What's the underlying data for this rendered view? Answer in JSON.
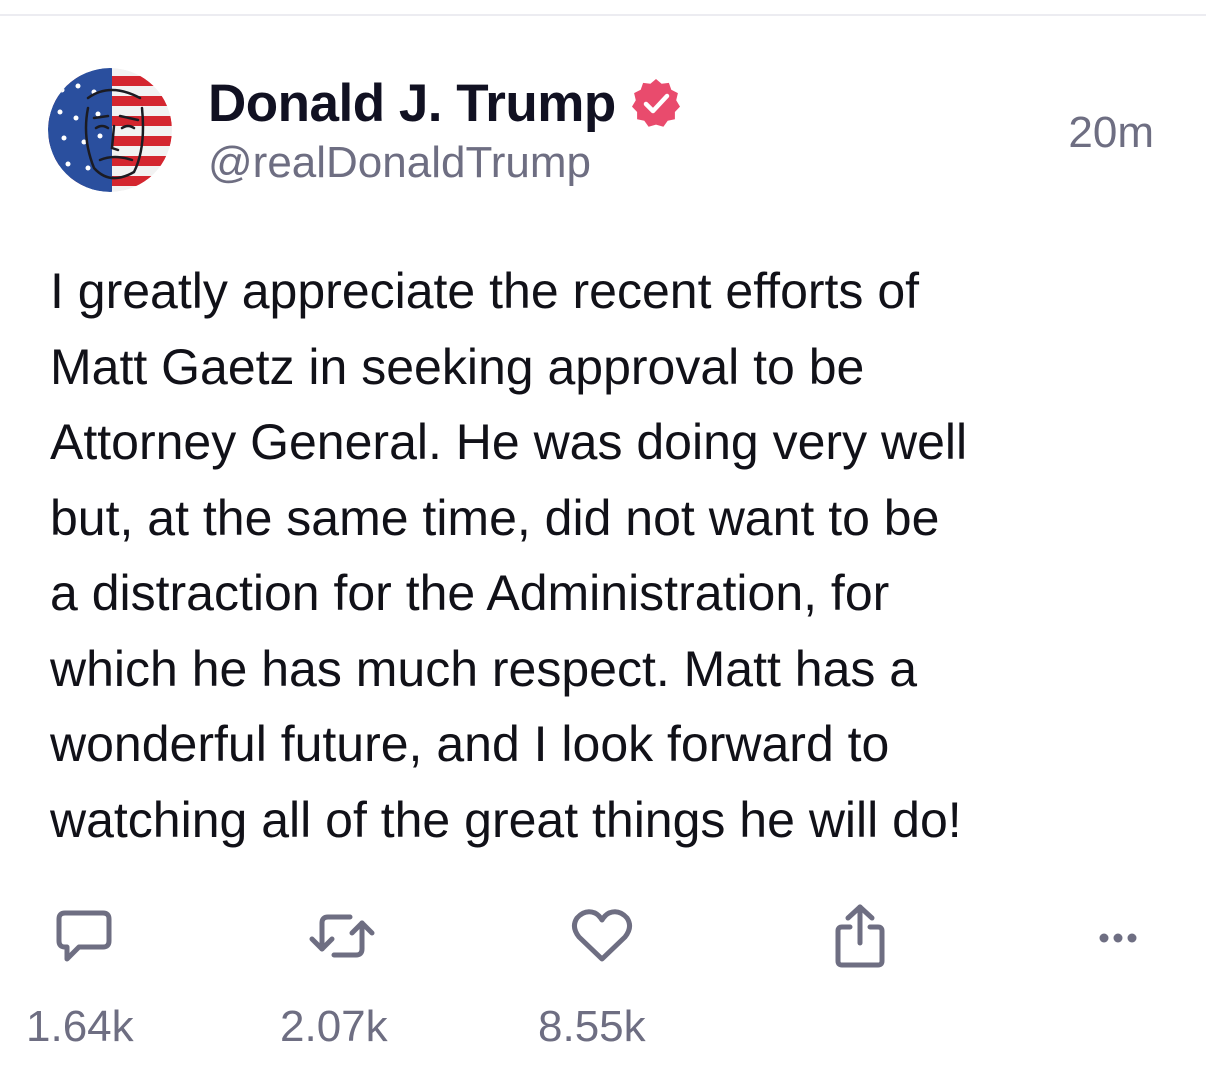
{
  "post": {
    "author": {
      "display_name": "Donald J. Trump",
      "handle": "@realDonaldTrump",
      "verified_icon": "verified-badge-icon",
      "avatar": "avatar-image"
    },
    "timestamp": "20m",
    "text": "I greatly appreciate the recent efforts of\nMatt Gaetz in seeking approval to be\nAttorney General. He was doing very well\nbut, at the same time, did not want to be\na distraction for the Administration, for\nwhich he has much respect. Matt has a\nwonderful future, and I look forward to\nwatching all of the great things he will do!"
  },
  "actions": {
    "reply": {
      "icon": "comment-icon",
      "count": "1.64k"
    },
    "repost": {
      "icon": "repost-icon",
      "count": "2.07k"
    },
    "like": {
      "icon": "heart-icon",
      "count": "8.55k"
    },
    "share": {
      "icon": "share-icon"
    },
    "more": {
      "icon": "more-icon"
    }
  },
  "colors": {
    "verified": "#e94b6d",
    "muted_text": "#6e6e82",
    "icon": "#6e6e82",
    "divider": "#ececf1"
  }
}
